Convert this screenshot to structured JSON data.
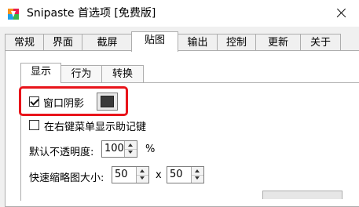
{
  "window": {
    "title": "Snipaste 首选项 [免费版]",
    "icon": "snipaste-logo-icon",
    "close": "close-icon"
  },
  "main_tabs": [
    "常规",
    "界面",
    "截屏",
    "贴图",
    "输出",
    "控制",
    "更新",
    "关于"
  ],
  "main_tab_selected": "贴图",
  "sub_tabs": [
    "显示",
    "行为",
    "转换"
  ],
  "sub_tab_selected": "显示",
  "settings": {
    "shadow": {
      "label": "窗口阴影",
      "checked": true,
      "color": "#3a3a3a"
    },
    "mnemonic": {
      "label": "在右键菜单显示助记键",
      "checked": false
    },
    "opacity": {
      "label": "默认不透明度:",
      "value": "100",
      "unit": "%"
    },
    "thumbnail": {
      "label": "快速缩略图大小:",
      "width": "50",
      "separator": "x",
      "height": "50"
    }
  },
  "colors": {
    "highlight": "#e8141a",
    "tab_border": "#adadad"
  }
}
